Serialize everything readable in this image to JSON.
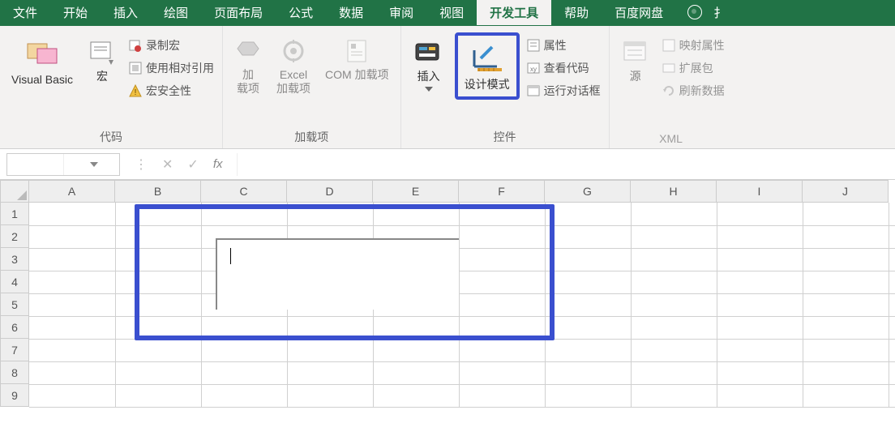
{
  "tabs": [
    "文件",
    "开始",
    "插入",
    "绘图",
    "页面布局",
    "公式",
    "数据",
    "审阅",
    "视图",
    "开发工具",
    "帮助",
    "百度网盘"
  ],
  "active_tab_index": 9,
  "ribbon": {
    "code": {
      "visual_basic": "Visual Basic",
      "macro": "宏",
      "record": "录制宏",
      "relative": "使用相对引用",
      "security": "宏安全性",
      "label": "代码"
    },
    "addins": {
      "addin": "加\n载项",
      "excel_addin": "Excel\n加载项",
      "com": "COM 加载项",
      "label": "加载项"
    },
    "controls": {
      "insert": "插入",
      "design": "设计模式",
      "props": "属性",
      "viewcode": "查看代码",
      "rundialog": "运行对话框",
      "label": "控件"
    },
    "xml": {
      "source": "源",
      "mapprops": "映射属性",
      "extpack": "扩展包",
      "refresh": "刷新数据",
      "label": "XML"
    }
  },
  "columns": [
    "A",
    "B",
    "C",
    "D",
    "E",
    "F",
    "G",
    "H",
    "I",
    "J"
  ],
  "rows": [
    "1",
    "2",
    "3",
    "4",
    "5",
    "6",
    "7",
    "8",
    "9"
  ]
}
